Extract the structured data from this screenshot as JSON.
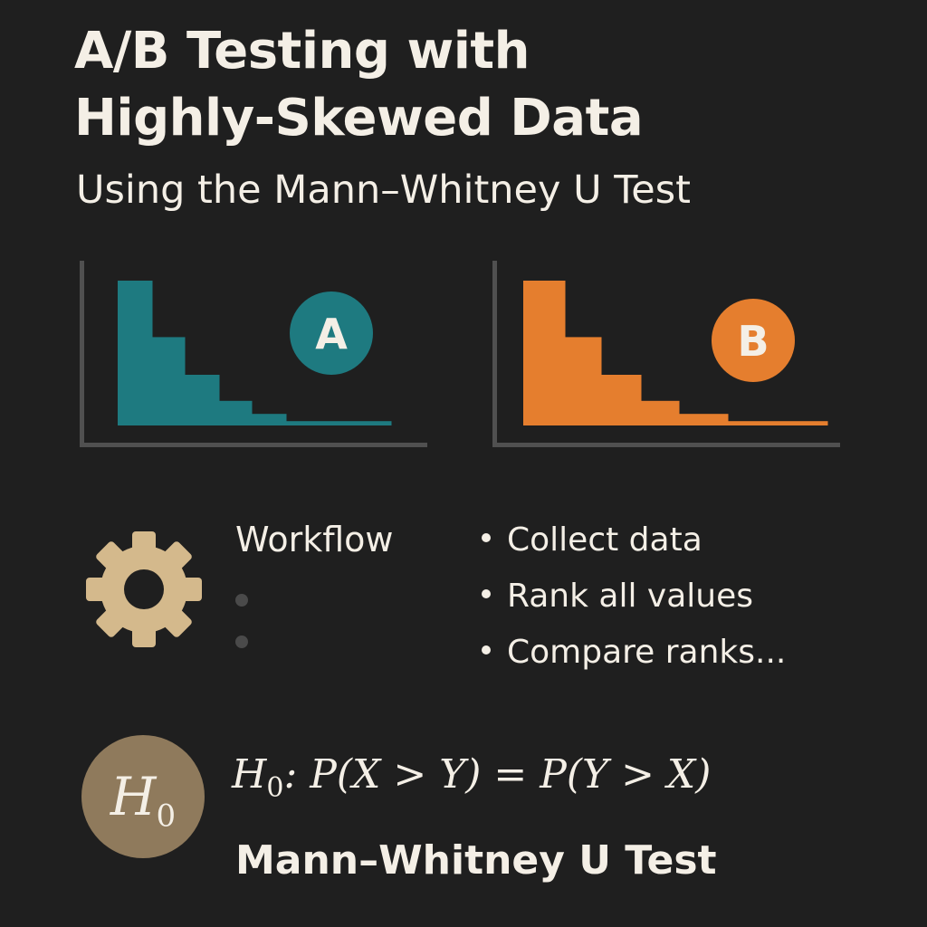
{
  "colors": {
    "background": "#1f1f1f",
    "text": "#f4efe6",
    "group_a": "#1e7a80",
    "group_b": "#e57e2e",
    "gear": "#d4b98c",
    "h0_badge": "#8f7a5c",
    "axis": "#505050"
  },
  "header": {
    "title_line1": "A/B Testing with",
    "title_line2": "Highly-Skewed Data",
    "subtitle": "Using the Mann–Whitney U Test"
  },
  "charts": {
    "group_a": {
      "label": "A",
      "icon": "letter-a-badge",
      "shape": "right-skewed-step-histogram",
      "relative_heights": [
        1.0,
        0.61,
        0.35,
        0.17,
        0.08,
        0.03
      ]
    },
    "group_b": {
      "label": "B",
      "icon": "letter-b-badge",
      "shape": "right-skewed-step-histogram",
      "relative_heights": [
        1.0,
        0.61,
        0.35,
        0.17,
        0.08,
        0.03
      ]
    }
  },
  "workflow": {
    "icon": "gear-icon",
    "title": "Workflow",
    "steps": [
      "Collect data",
      "Rank all values",
      "Compare ranks..."
    ]
  },
  "hypothesis": {
    "badge_symbol": "H",
    "badge_subscript": "0",
    "formula_parts": [
      "H",
      "0",
      ": P(X > Y) = P(Y > X)"
    ],
    "test_name": "Mann–Whitney U Test"
  }
}
